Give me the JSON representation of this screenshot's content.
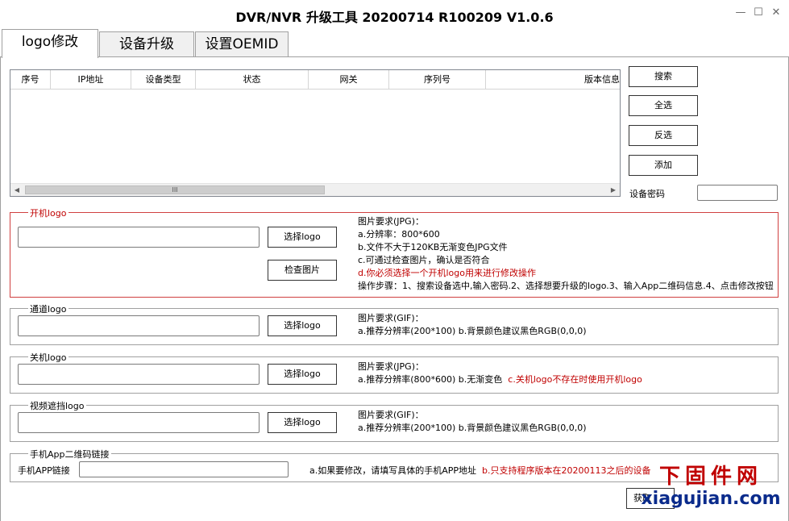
{
  "window": {
    "title": "DVR/NVR 升级工具 20200714 R100209 V1.0.6",
    "minimize": "—",
    "maximize": "☐",
    "close": "✕"
  },
  "tabs": [
    {
      "label": "logo修改",
      "active": true
    },
    {
      "label": "设备升级",
      "active": false
    },
    {
      "label": "设置OEMID",
      "active": false
    }
  ],
  "device_table": {
    "columns": [
      "序号",
      "IP地址",
      "设备类型",
      "状态",
      "网关",
      "序列号",
      "版本信息"
    ],
    "rows": [],
    "scroll_thumb_grip": "III"
  },
  "side_buttons": {
    "search": "搜索",
    "select_all": "全选",
    "invert": "反选",
    "add": "添加"
  },
  "device_password": {
    "label": "设备密码",
    "value": ""
  },
  "boot_logo": {
    "title": "开机logo",
    "path": "",
    "select_button": "选择logo",
    "check_button": "检查图片",
    "requirements": [
      "图片要求(JPG)：",
      "a.分辨率：800*600",
      "b.文件不大于120KB无渐变色JPG文件",
      "c.可通过检查图片，确认是否符合",
      "d.你必须选择一个开机logo用来进行修改操作",
      "操作步骤：1、搜索设备选中,输入密码.2、选择想要升级的logo.3、输入App二维码信息.4、点击修改按钮"
    ]
  },
  "channel_logo": {
    "title": "通道logo",
    "path": "",
    "select_button": "选择logo",
    "requirements": [
      "图片要求(GIF)：",
      "a.推荐分辨率(200*100)  b.背景颜色建议黑色RGB(0,0,0)"
    ]
  },
  "shutdown_logo": {
    "title": "关机logo",
    "path": "",
    "select_button": "选择logo",
    "requirements": [
      "图片要求(JPG)：",
      "a.推荐分辨率(800*600)  b.无渐变色"
    ],
    "requirements_red": "c.关机logo不存在时使用开机logo"
  },
  "video_mask_logo": {
    "title": "视频遮挡logo",
    "path": "",
    "select_button": "选择logo",
    "requirements": [
      "图片要求(GIF)：",
      "a.推荐分辨率(200*100)  b.背景颜色建议黑色RGB(0,0,0)"
    ]
  },
  "app_qr": {
    "title": "手机App二维码链接",
    "link_label": "手机APP链接",
    "link_value": "",
    "note": "a.如果要修改，请填写具体的手机APP地址",
    "note_red": "b.只支持程序版本在20200113之后的设备"
  },
  "bottom_button": "获取",
  "watermark": {
    "cn": "下固件网",
    "en": "xiagujian.com"
  },
  "colors": {
    "warning_red": "#c00000",
    "watermark_blue": "#0a2b8c",
    "border_gray": "#a0a0a0"
  }
}
